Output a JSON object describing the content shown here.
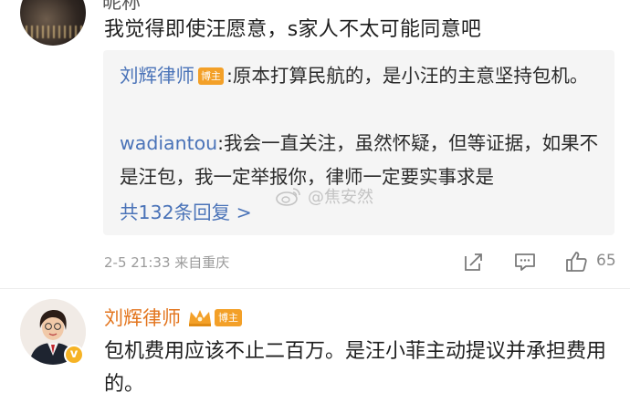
{
  "top_comment": {
    "author_cut": "昵称",
    "text": "我觉得即使汪愿意，s家人不太可能同意吧"
  },
  "replies": [
    {
      "author": "刘辉律师",
      "badge": "博主",
      "separator": ":",
      "text": "原本打算民航的，是小汪的主意坚持包机。"
    },
    {
      "author": "wadiantou",
      "separator": ":",
      "text": "我会一直关注，虽然怀疑，但等证据，如果不是汪包，我一定举报你，律师一定要实事求是"
    }
  ],
  "more_replies": "共132条回复 >",
  "watermark": "@焦安然",
  "meta": {
    "time": "2-5 21:33",
    "location": "来自重庆"
  },
  "actions": {
    "share_icon": "share-icon",
    "comment_icon": "comment-icon",
    "like_icon": "thumbs-up-icon",
    "like_count": "65"
  },
  "second_comment": {
    "author": "刘辉律师",
    "badge": "博主",
    "text": "包机费用应该不止二百万。是汪小菲主动提议并承担费用的。"
  },
  "colors": {
    "link": "#4a73b8",
    "vip_name": "#e3751e",
    "badge": "#f3a028",
    "reply_bg": "#f5f5f5"
  }
}
